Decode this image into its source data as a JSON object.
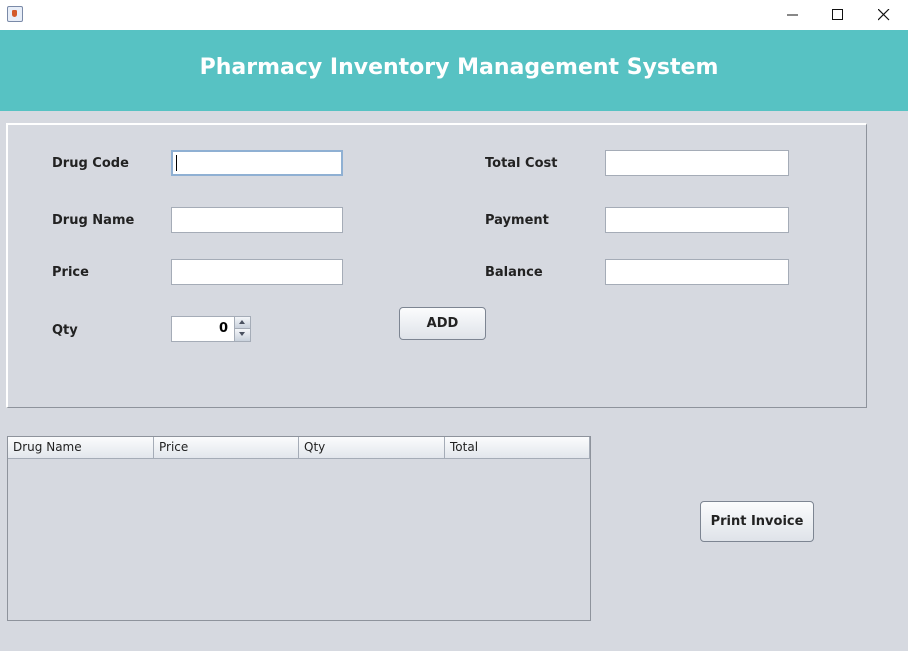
{
  "header": {
    "title": "Pharmacy Inventory Management System"
  },
  "form": {
    "drug_code": {
      "label": "Drug Code",
      "value": ""
    },
    "drug_name": {
      "label": "Drug Name",
      "value": ""
    },
    "price": {
      "label": "Price",
      "value": ""
    },
    "qty": {
      "label": "Qty",
      "value": "0"
    },
    "total_cost": {
      "label": "Total Cost",
      "value": ""
    },
    "payment": {
      "label": "Payment",
      "value": ""
    },
    "balance": {
      "label": "Balance",
      "value": ""
    },
    "add_label": "ADD"
  },
  "table": {
    "columns": [
      "Drug Name",
      "Price",
      "Qty",
      "Total"
    ],
    "rows": []
  },
  "actions": {
    "print_invoice_label": "Print Invoice"
  },
  "icons": {
    "app": "java-cup-icon",
    "minimize": "minimize-icon",
    "maximize": "maximize-icon",
    "close": "close-icon"
  }
}
